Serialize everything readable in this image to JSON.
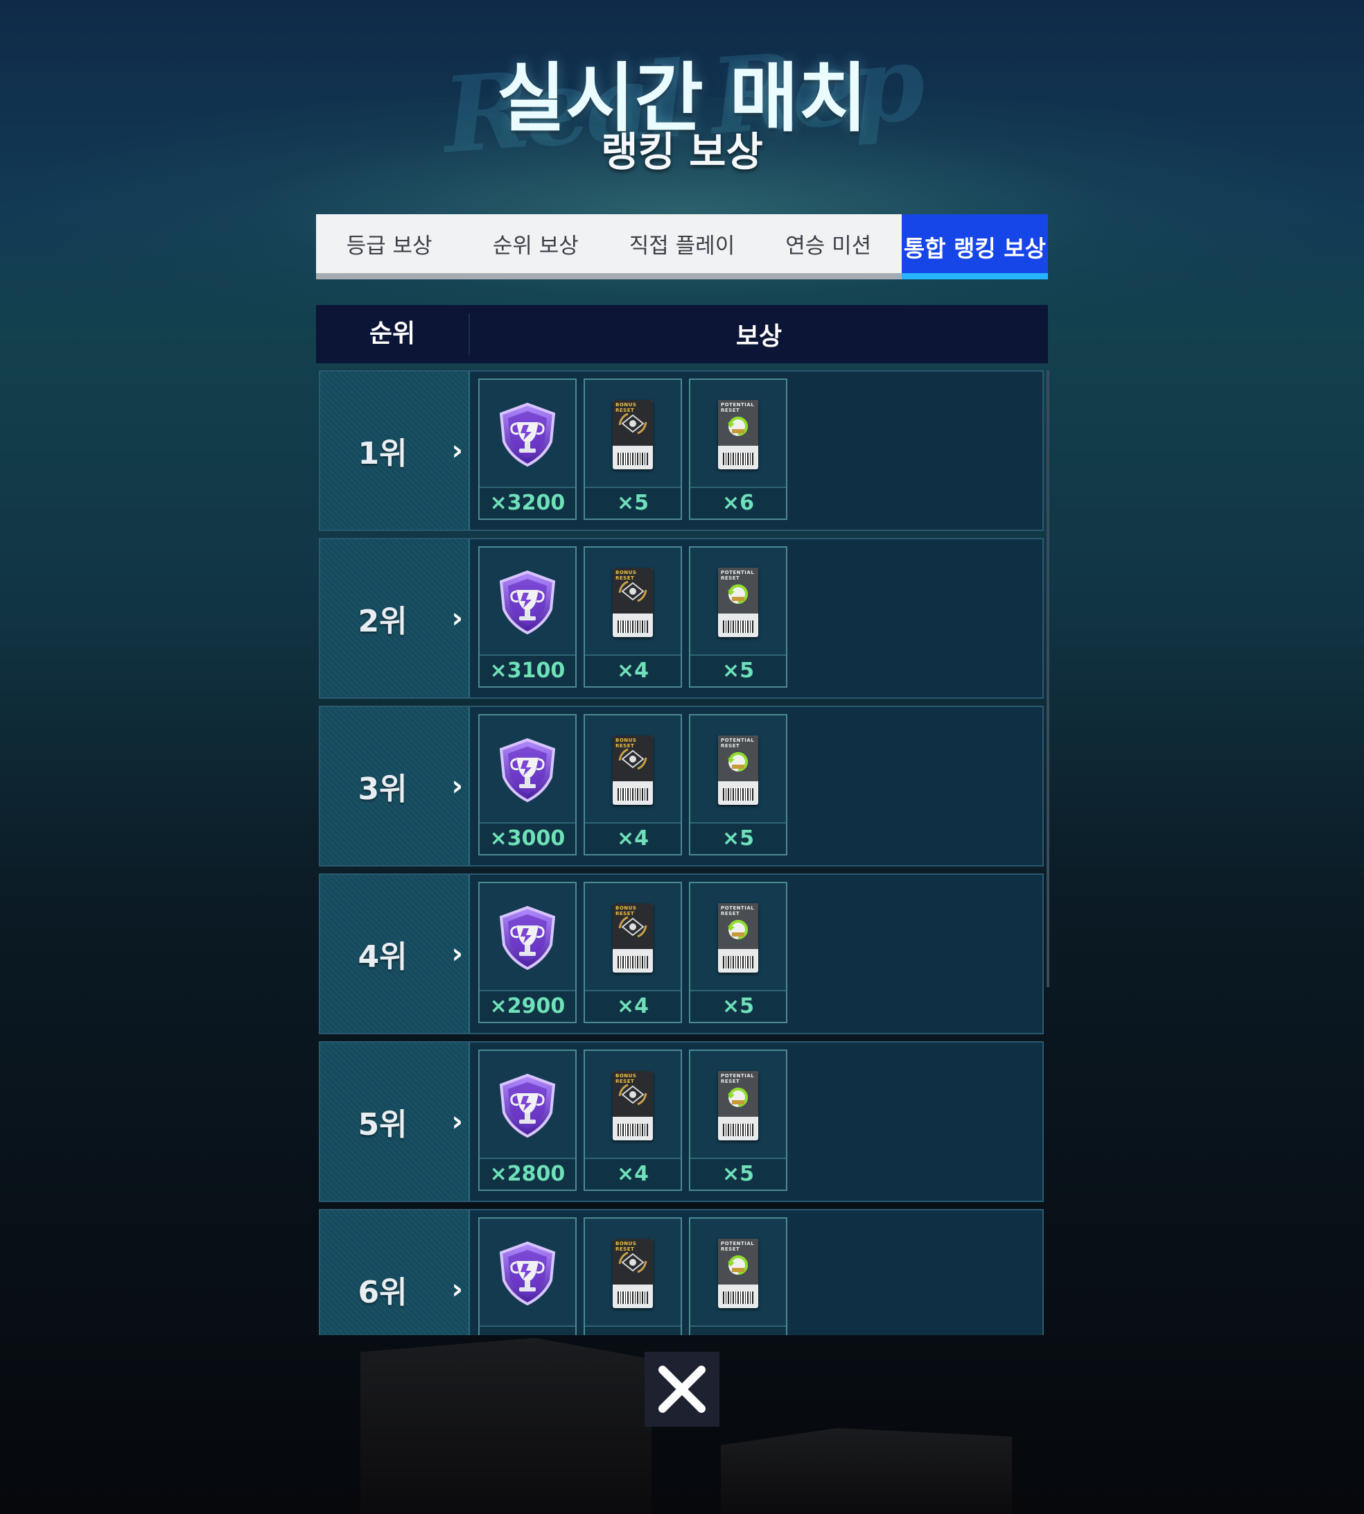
{
  "header": {
    "title": "실시간 매치",
    "subtitle": "랭킹 보상",
    "bg_script": "Real Rep"
  },
  "tabs": [
    {
      "label": "등급 보상",
      "active": false
    },
    {
      "label": "순위 보상",
      "active": false
    },
    {
      "label": "직접 플레이",
      "active": false
    },
    {
      "label": "연승 미션",
      "active": false
    },
    {
      "label": "통합 랭킹 보상",
      "active": true
    }
  ],
  "table": {
    "col_rank": "순위",
    "col_reward": "보상"
  },
  "rows": [
    {
      "rank": "1위",
      "rewards": [
        {
          "icon": "trophy-shield-icon",
          "qty": "×3200"
        },
        {
          "icon": "bonus-reset-ticket-icon",
          "qty": "×5"
        },
        {
          "icon": "potential-reset-ticket-icon",
          "qty": "×6"
        }
      ]
    },
    {
      "rank": "2위",
      "rewards": [
        {
          "icon": "trophy-shield-icon",
          "qty": "×3100"
        },
        {
          "icon": "bonus-reset-ticket-icon",
          "qty": "×4"
        },
        {
          "icon": "potential-reset-ticket-icon",
          "qty": "×5"
        }
      ]
    },
    {
      "rank": "3위",
      "rewards": [
        {
          "icon": "trophy-shield-icon",
          "qty": "×3000"
        },
        {
          "icon": "bonus-reset-ticket-icon",
          "qty": "×4"
        },
        {
          "icon": "potential-reset-ticket-icon",
          "qty": "×5"
        }
      ]
    },
    {
      "rank": "4위",
      "rewards": [
        {
          "icon": "trophy-shield-icon",
          "qty": "×2900"
        },
        {
          "icon": "bonus-reset-ticket-icon",
          "qty": "×4"
        },
        {
          "icon": "potential-reset-ticket-icon",
          "qty": "×5"
        }
      ]
    },
    {
      "rank": "5위",
      "rewards": [
        {
          "icon": "trophy-shield-icon",
          "qty": "×2800"
        },
        {
          "icon": "bonus-reset-ticket-icon",
          "qty": "×4"
        },
        {
          "icon": "potential-reset-ticket-icon",
          "qty": "×5"
        }
      ]
    },
    {
      "rank": "6위",
      "rewards": [
        {
          "icon": "trophy-shield-icon",
          "qty": ""
        },
        {
          "icon": "bonus-reset-ticket-icon",
          "qty": ""
        },
        {
          "icon": "potential-reset-ticket-icon",
          "qty": ""
        }
      ]
    }
  ],
  "ticket_captions": {
    "bonus": "BONUS RESET",
    "potential": "POTENTIAL RESET"
  },
  "colors": {
    "active_tab": "#1746e8",
    "active_tab_underline": "#27b4ff",
    "qty_text": "#6fe0b8",
    "trophy_purple": "#7a3fd0"
  },
  "close_button": {
    "icon": "close-icon"
  }
}
